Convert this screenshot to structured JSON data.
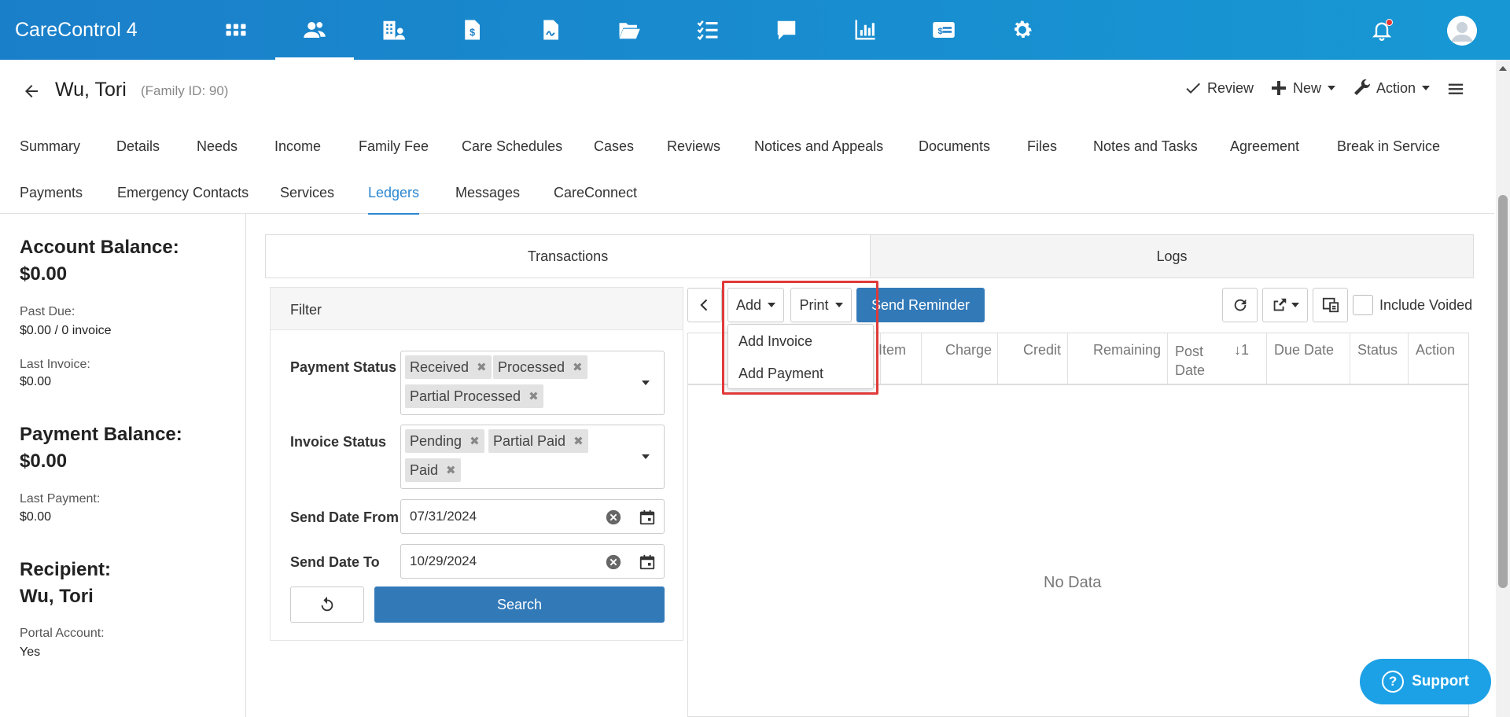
{
  "app": {
    "title": "CareControl 4"
  },
  "nav": {
    "icons": [
      "apps-grid-icon",
      "people-icon",
      "building-icon",
      "invoice-dollar-icon",
      "document-signature-icon",
      "folder-open-icon",
      "checklist-icon",
      "chat-icon",
      "bar-chart-icon",
      "payment-card-icon",
      "gear-icon"
    ]
  },
  "header": {
    "title": "Wu, Tori",
    "family_id": "(Family ID: 90)",
    "review_label": "Review",
    "new_label": "New",
    "action_label": "Action"
  },
  "tabs": {
    "row1": [
      "Summary",
      "Details",
      "Needs",
      "Income",
      "Family Fee",
      "Care Schedules",
      "Cases",
      "Reviews",
      "Notices and Appeals",
      "Documents",
      "Files",
      "Notes and Tasks",
      "Agreement",
      "Break in Service"
    ],
    "row2": [
      "Payments",
      "Emergency Contacts",
      "Services",
      "Ledgers",
      "Messages",
      "CareConnect"
    ],
    "active": "Ledgers"
  },
  "sidebar": {
    "account_balance_label": "Account Balance:",
    "account_balance_value": "$0.00",
    "past_due_label": "Past Due:",
    "past_due_value": "$0.00 / 0 invoice",
    "last_invoice_label": "Last Invoice:",
    "last_invoice_value": "$0.00",
    "payment_balance_label": "Payment Balance:",
    "payment_balance_value": "$0.00",
    "last_payment_label": "Last Payment:",
    "last_payment_value": "$0.00",
    "recipient_label": "Recipient:",
    "recipient_value": "Wu, Tori",
    "portal_label": "Portal Account:",
    "portal_value": "Yes"
  },
  "subtabs": {
    "transactions": "Transactions",
    "logs": "Logs"
  },
  "filter": {
    "title": "Filter",
    "payment_status_label": "Payment Status",
    "payment_status_chips": [
      "Received",
      "Processed",
      "Partial Processed"
    ],
    "invoice_status_label": "Invoice Status",
    "invoice_status_chips": [
      "Pending",
      "Partial Paid",
      "Paid"
    ],
    "send_date_from_label": "Send Date From",
    "send_date_from_value": "07/31/2024",
    "send_date_to_label": "Send Date To",
    "send_date_to_value": "10/29/2024",
    "search_label": "Search"
  },
  "toolbar": {
    "add_label": "Add",
    "print_label": "Print",
    "send_reminder_label": "Send Reminder",
    "include_voided_label": "Include Voided"
  },
  "add_menu": {
    "items": [
      "Add Invoice",
      "Add Payment"
    ]
  },
  "grid": {
    "columns": [
      "Item",
      "Charge",
      "Credit",
      "Remaining",
      "Post Date",
      "Due Date",
      "Status",
      "Action"
    ],
    "sort_indicator": "1",
    "empty_text": "No Data"
  },
  "support": {
    "label": "Support"
  },
  "colors": {
    "topbar": "#1a7fc9",
    "primary": "#3279b8",
    "active_tab": "#2d87d0",
    "highlight": "#e03a3a",
    "support": "#1da1e6"
  }
}
